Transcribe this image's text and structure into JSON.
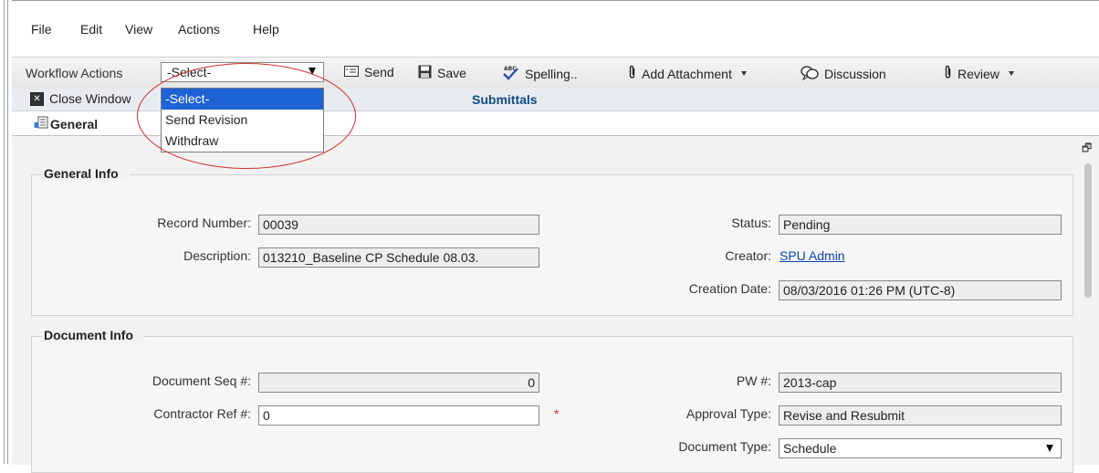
{
  "menu": [
    "File",
    "Edit",
    "View",
    "Actions",
    "Help"
  ],
  "toolbar": {
    "workflow_label": "Workflow Actions",
    "select_value": "-Select-",
    "send": "Send",
    "save": "Save",
    "spelling": "Spelling..",
    "add_attachment": "Add Attachment",
    "discussion": "Discussion",
    "review": "Review"
  },
  "dropdown": {
    "options": [
      "-Select-",
      "Send Revision",
      "Withdraw"
    ],
    "selected": "-Select-"
  },
  "bar2": {
    "close_window": "Close Window",
    "title": "Submittals"
  },
  "tab": {
    "title": "General"
  },
  "general_info": {
    "section_title": "General Info",
    "record_number_label": "Record Number:",
    "record_number": "00039",
    "description_label": "Description:",
    "description": "013210_Baseline CP Schedule 08.03.",
    "status_label": "Status:",
    "status": "Pending",
    "creator_label": "Creator:",
    "creator": "SPU Admin",
    "creation_date_label": "Creation Date:",
    "creation_date": "08/03/2016 01:26 PM (UTC-8)"
  },
  "document_info": {
    "section_title": "Document Info",
    "doc_seq_label": "Document Seq #:",
    "doc_seq": "0",
    "contractor_ref_label": "Contractor Ref #:",
    "contractor_ref": "0",
    "required_mark": "*",
    "pw_label": "PW #:",
    "pw": "2013-cap",
    "approval_type_label": "Approval Type:",
    "approval_type": "Revise and Resubmit",
    "document_type_label": "Document Type:",
    "document_type": "Schedule"
  },
  "colors": {
    "highlight": "#1e63d6",
    "title_blue": "#0e4a84",
    "annotation_red": "#d0302f"
  }
}
